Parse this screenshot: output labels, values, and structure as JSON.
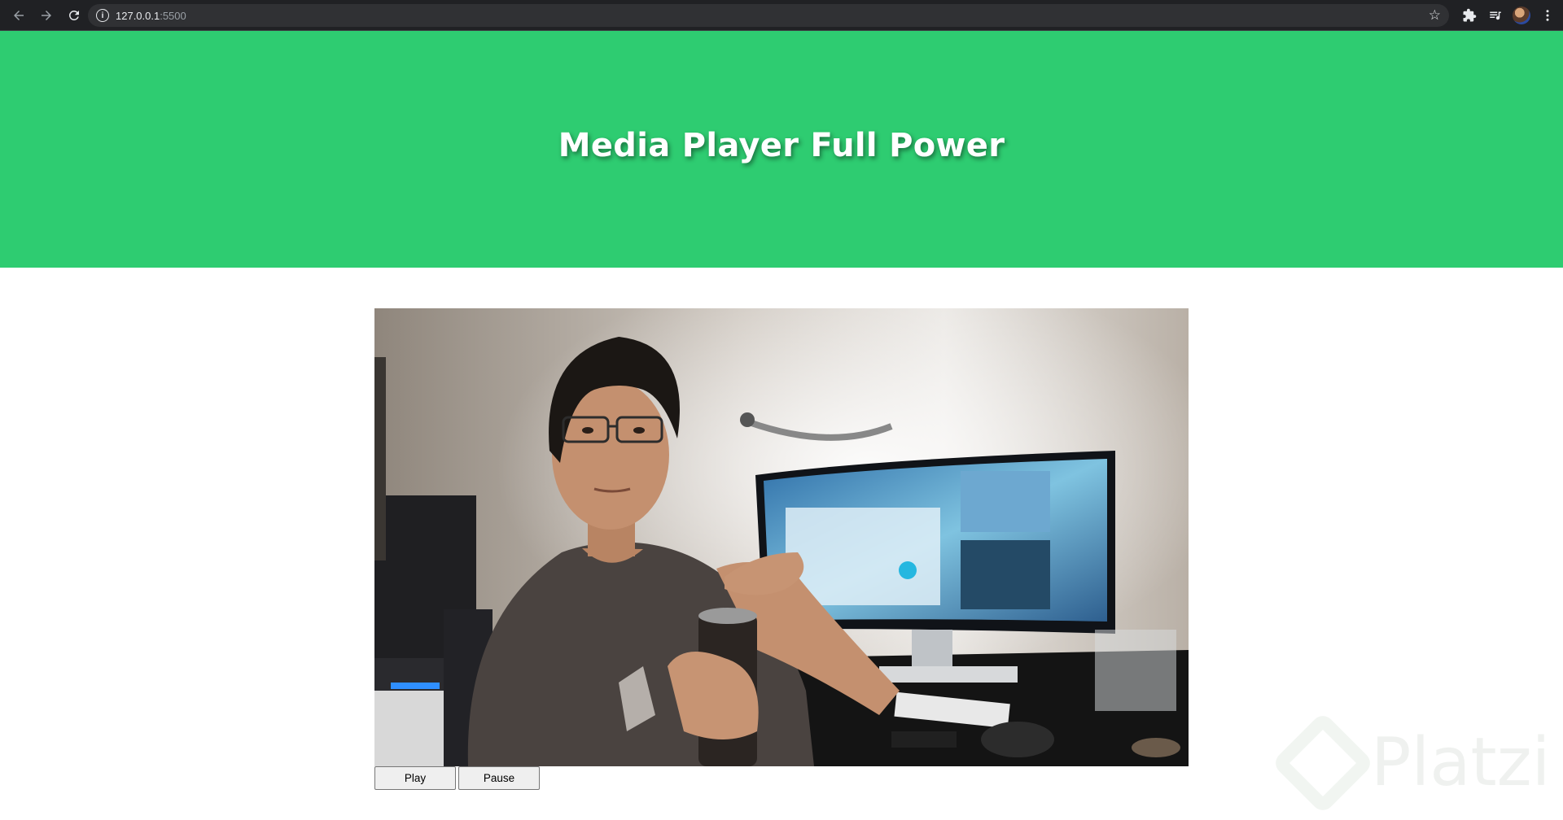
{
  "browser": {
    "url_host": "127.0.0.1",
    "url_port": ":5500"
  },
  "page": {
    "title": "Media Player Full Power"
  },
  "controls": {
    "play_label": "Play",
    "pause_label": "Pause"
  },
  "watermark": {
    "text": "Platzi"
  },
  "icons": {
    "back": "arrow-left-icon",
    "forward": "arrow-right-icon",
    "reload": "reload-icon",
    "site_info": "info-icon",
    "bookmark": "star-icon",
    "extensions": "puzzle-icon",
    "media": "media-queue-icon",
    "menu": "more-vertical-icon"
  },
  "colors": {
    "header_bg": "#2ecc71",
    "header_text": "#ffffff"
  }
}
